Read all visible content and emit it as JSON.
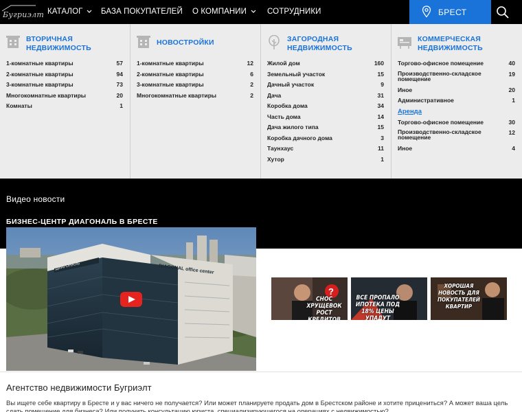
{
  "logo": {
    "text": "Бугриэлт"
  },
  "nav": {
    "catalog": "КАТАЛОГ",
    "buyers": "БАЗА ПОКУПАТЕЛЕЙ",
    "about": "О КОМПАНИИ",
    "staff": "СОТРУДНИКИ",
    "city": "БРЕСТ"
  },
  "catalog": {
    "columns": [
      {
        "title_line1": "ВТОРИЧНАЯ",
        "title_line2": "НЕДВИЖИМОСТЬ",
        "icon": "apartment-building-icon",
        "items": [
          {
            "label": "1-комнатные квартиры",
            "count": "57"
          },
          {
            "label": "2-комнатные квартиры",
            "count": "94"
          },
          {
            "label": "3-комнатные квартиры",
            "count": "73"
          },
          {
            "label": "Многокомнатные квартиры",
            "count": "20"
          },
          {
            "label": "Комнаты",
            "count": "1"
          }
        ]
      },
      {
        "title_line1": "НОВОСТРОЙКИ",
        "title_line2": "",
        "icon": "new-building-icon",
        "items": [
          {
            "label": "1-комнатные квартиры",
            "count": "12"
          },
          {
            "label": "2-комнатные квартиры",
            "count": "6"
          },
          {
            "label": "3-комнатные квартиры",
            "count": "2"
          },
          {
            "label": "Многокомнатные квартиры",
            "count": "2"
          }
        ]
      },
      {
        "title_line1": "ЗАГОРОДНАЯ",
        "title_line2": "НЕДВИЖИМОСТЬ",
        "icon": "tree-icon",
        "items": [
          {
            "label": "Жилой дом",
            "count": "160"
          },
          {
            "label": "Земельный участок",
            "count": "15"
          },
          {
            "label": "Дачный участок",
            "count": "9"
          },
          {
            "label": "Дача",
            "count": "31"
          },
          {
            "label": "Коробка дома",
            "count": "34"
          },
          {
            "label": "Часть дома",
            "count": "14"
          },
          {
            "label": "Дача жилого типа",
            "count": "15"
          },
          {
            "label": "Коробка дачного дома",
            "count": "3"
          },
          {
            "label": "Таунхаус",
            "count": "11"
          },
          {
            "label": "Хутор",
            "count": "1"
          }
        ]
      },
      {
        "title_line1": "КОММЕРЧЕСКАЯ",
        "title_line2": "НЕДВИЖИМОСТЬ",
        "icon": "commercial-sign-icon",
        "items": [
          {
            "label": "Торгово-офисное помещение",
            "count": "40"
          },
          {
            "label": "Производственно-складское помещение",
            "count": "19"
          },
          {
            "label": "Иное",
            "count": "20"
          },
          {
            "label": "Административное",
            "count": "1"
          }
        ],
        "rent_label": "Аренда",
        "rent_items": [
          {
            "label": "Торгово-офисное помещение",
            "count": "30"
          },
          {
            "label": "Производственно-складское помещение",
            "count": "12"
          },
          {
            "label": "Иное",
            "count": "4"
          }
        ]
      }
    ]
  },
  "video": {
    "heading": "Видео новости",
    "title": "БИЗНЕС-ЦЕНТР ДИАГОНАЛЬ В БРЕСТЕ",
    "building_sign": "DIAGONAL office center",
    "building_sign_ru": "ДИАГОНАЛЬ",
    "thumbs": [
      {
        "text": "СНОС ХРУЩЕВОК РОСТ КРЕДИТОВ ЗАПРЕТ АГЕНТОВ"
      },
      {
        "text": "ВСЕ ПРОПАЛО ИПОТЕКА ПОД 18% ЦЕНЫ УПАДУТ"
      },
      {
        "text": "ХОРОШАЯ НОВОСТЬ ДЛЯ ПОКУПАТЕЛЕЙ КВАРТИР"
      }
    ]
  },
  "agency": {
    "title": "Агентство недвижимости Бугриэлт",
    "text": "Вы ищете себе квартиру в Бресте и у вас ничего не получается? Или может планируете продать дом в Брестском районе и хотите прицениться? А может ваша цель сдать помещение для бизнеса? Или получить консультацию юриста, специализирующегося на операциях с недвижимостью?"
  },
  "colors": {
    "accent": "#1a73d9",
    "nav_bg": "#000000",
    "panel_bg": "#ececec"
  }
}
